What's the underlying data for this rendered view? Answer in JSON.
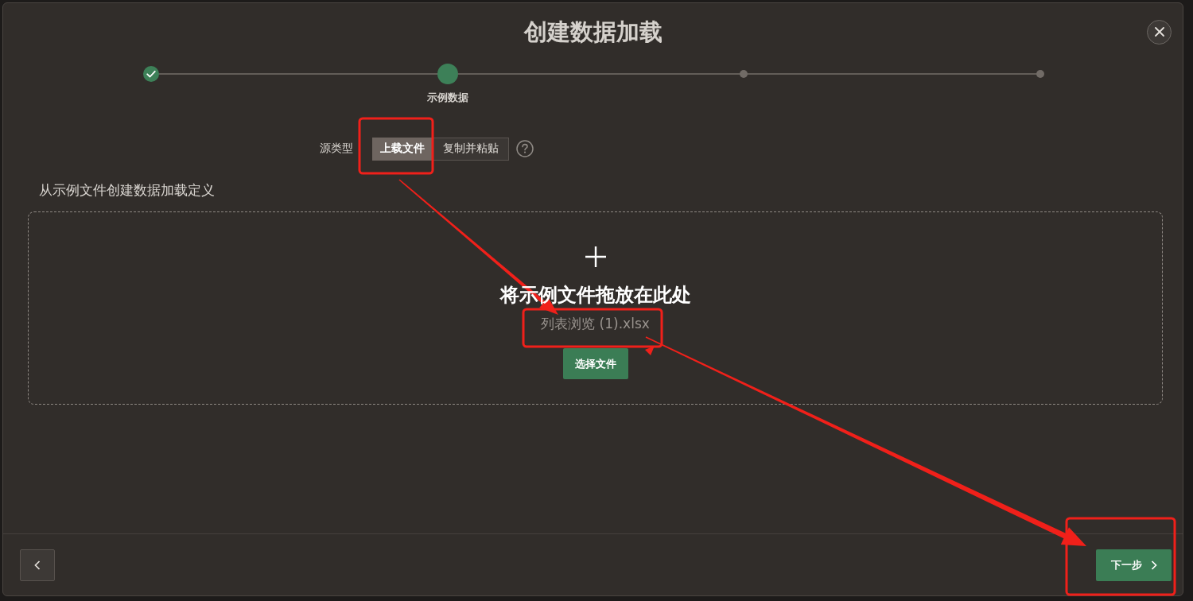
{
  "dialog": {
    "title": "创建数据加载"
  },
  "steps": [
    {
      "completed": true,
      "selected": false
    },
    {
      "completed": false,
      "selected": true,
      "label": "示例数据"
    },
    {
      "completed": false,
      "selected": false
    },
    {
      "completed": false,
      "selected": false
    }
  ],
  "source_type": {
    "label": "源类型",
    "options": [
      {
        "label": "上载文件",
        "selected": true
      },
      {
        "label": "复制并粘贴",
        "selected": false
      }
    ]
  },
  "section_title": "从示例文件创建数据加载定义",
  "drop_zone": {
    "heading": "将示例文件拖放在此处",
    "file_name": "列表浏览 (1).xlsx",
    "button": "选择文件"
  },
  "footer": {
    "next_button": "下一步"
  },
  "annotations": [
    {
      "kind": "box"
    },
    {
      "kind": "box"
    },
    {
      "kind": "box"
    },
    {
      "kind": "arrow"
    },
    {
      "kind": "arrow"
    }
  ]
}
